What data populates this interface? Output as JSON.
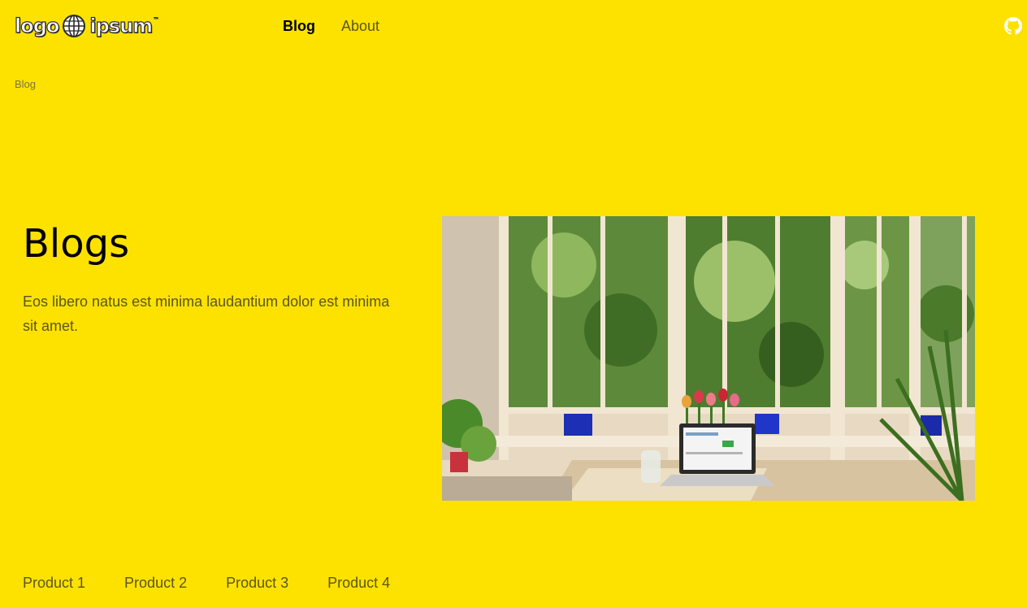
{
  "header": {
    "logo_text_left": "logo",
    "logo_text_right": "ipsum",
    "logo_tm": "™",
    "nav": [
      {
        "label": "Blog",
        "active": true
      },
      {
        "label": "About",
        "active": false
      }
    ],
    "github_icon": "github-icon"
  },
  "breadcrumb": {
    "current": "Blog"
  },
  "hero": {
    "title": "Blogs",
    "description": "Eos libero natus est minima laudantium dolor est minima sit amet.",
    "image_subject": "sunlit bay window with plants, tulips, laptop and glass jar on a table"
  },
  "products": [
    {
      "label": "Product 1"
    },
    {
      "label": "Product 2"
    },
    {
      "label": "Product 3"
    },
    {
      "label": "Product 4"
    }
  ],
  "colors": {
    "background": "#FDE200",
    "text_primary": "#000000",
    "text_muted": "#5b5520",
    "breadcrumb": "#7b7440"
  }
}
